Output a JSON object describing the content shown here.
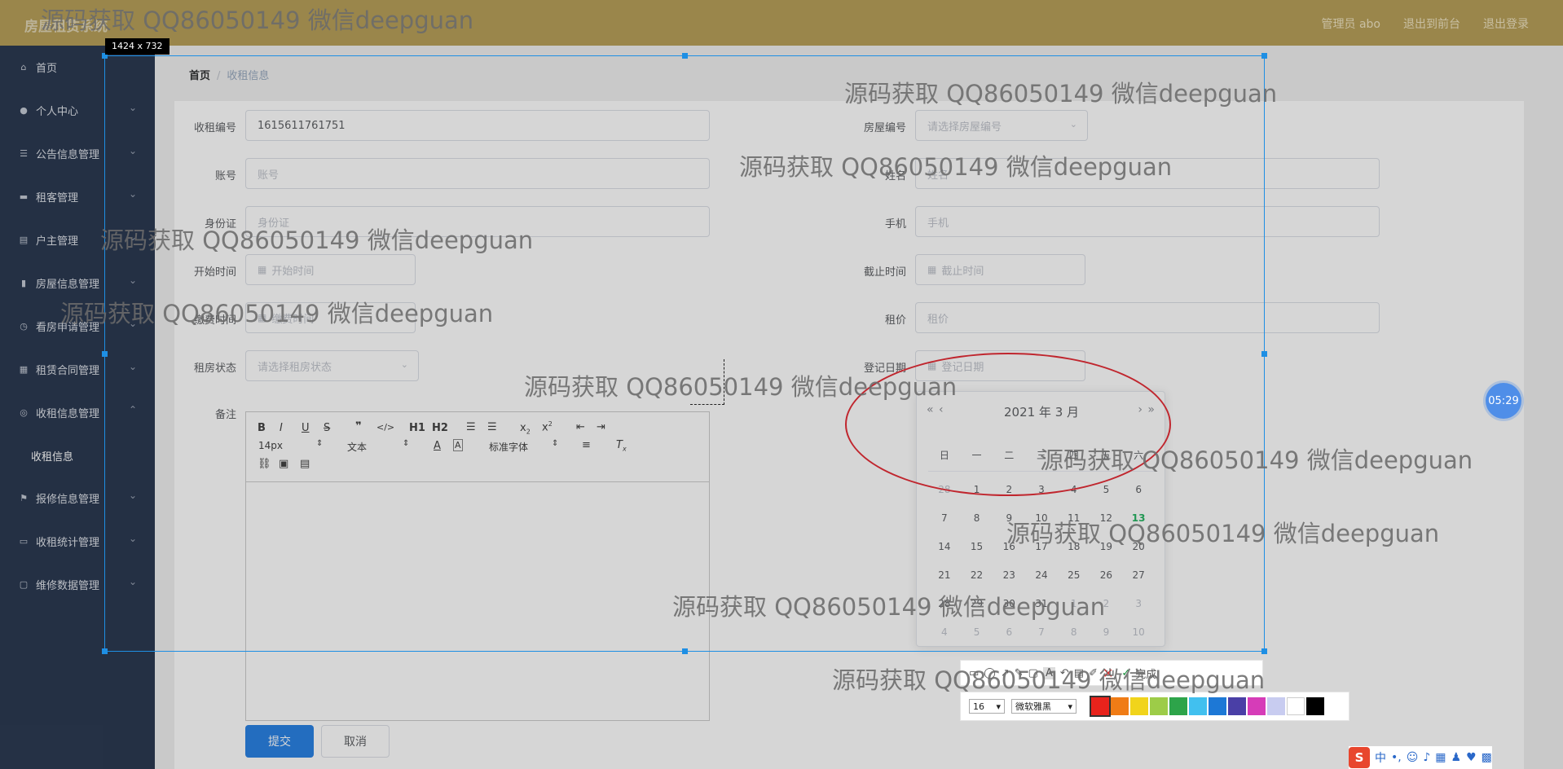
{
  "app": {
    "brand": "房屋租赁系统"
  },
  "header": {
    "links": [
      "管理员 abo",
      "退出到前台",
      "退出登录"
    ]
  },
  "sidebar": {
    "items": [
      {
        "label": "首页",
        "icon": "home-icon"
      },
      {
        "label": "个人中心",
        "icon": "user-icon"
      },
      {
        "label": "公告信息管理",
        "icon": "menu-icon"
      },
      {
        "label": "租客管理",
        "icon": "id-card-icon"
      },
      {
        "label": "户主管理",
        "icon": "document-icon"
      },
      {
        "label": "房屋信息管理",
        "icon": "bar-chart-icon"
      },
      {
        "label": "看房申请管理",
        "icon": "clock-icon"
      },
      {
        "label": "租赁合同管理",
        "icon": "calendar-icon"
      },
      {
        "label": "收租信息管理",
        "icon": "compass-icon"
      },
      {
        "label": "报修信息管理",
        "icon": "flag-icon"
      },
      {
        "label": "收租统计管理",
        "icon": "monitor-icon"
      },
      {
        "label": "维修数据管理",
        "icon": "chat-icon"
      }
    ],
    "subitem": "收租信息"
  },
  "breadcrumb": {
    "home": "首页",
    "sep": "/",
    "current": "收租信息"
  },
  "form": {
    "fields": {
      "rent_no": {
        "label": "收租编号",
        "value": "1615611761751"
      },
      "house_no": {
        "label": "房屋编号",
        "placeholder": "请选择房屋编号"
      },
      "account": {
        "label": "账号",
        "placeholder": "账号"
      },
      "name": {
        "label": "姓名",
        "placeholder": "姓名"
      },
      "id_card": {
        "label": "身份证",
        "placeholder": "身份证"
      },
      "phone": {
        "label": "手机",
        "placeholder": "手机"
      },
      "start_time": {
        "label": "开始时间",
        "placeholder": "开始时间"
      },
      "end_time": {
        "label": "截止时间",
        "placeholder": "截止时间"
      },
      "pay_time": {
        "label": "缴费时间",
        "placeholder": "缴费时间"
      },
      "rent_price": {
        "label": "租价",
        "placeholder": "租价"
      },
      "rent_status": {
        "label": "租房状态",
        "placeholder": "请选择租房状态"
      },
      "reg_date": {
        "label": "登记日期",
        "placeholder": "登记日期"
      },
      "remark": {
        "label": "备注"
      }
    },
    "editor": {
      "font_size": "14px",
      "block_type": "文本",
      "font_family": "标准字体",
      "h1": "H1",
      "h2": "H2"
    },
    "submit": "提交",
    "cancel": "取消"
  },
  "datepicker": {
    "title": "2021 年  3 月",
    "prev_year": "«",
    "prev_month": "‹",
    "next_month": "›",
    "next_year": "»",
    "weekdays": [
      "日",
      "一",
      "二",
      "三",
      "四",
      "五",
      "六"
    ],
    "days": [
      "28",
      "1",
      "2",
      "3",
      "4",
      "5",
      "6",
      "7",
      "8",
      "9",
      "10",
      "11",
      "12",
      "13",
      "14",
      "15",
      "16",
      "17",
      "18",
      "19",
      "20",
      "21",
      "22",
      "23",
      "24",
      "25",
      "26",
      "27",
      "28",
      "29",
      "30",
      "31",
      "1",
      "2",
      "3",
      "4",
      "5",
      "6",
      "7",
      "8",
      "9",
      "10"
    ],
    "today": "13"
  },
  "screenshot_tool": {
    "size_label": "1424 x 732",
    "done": "完成",
    "font_size": "16",
    "font_name": "微软雅黑",
    "colors": [
      "#e8231c",
      "#f07c16",
      "#f1d41b",
      "#9dcc48",
      "#2da44a",
      "#41c0ef",
      "#1d78d6",
      "#4a3fa6",
      "#d63cb8",
      "#c8ccf0",
      "#ffffff",
      "#000000"
    ]
  },
  "timer": "05:29",
  "ime": {
    "logo": "S",
    "mode": "中"
  },
  "watermark": "源码获取 QQ86050149 微信deepguan"
}
